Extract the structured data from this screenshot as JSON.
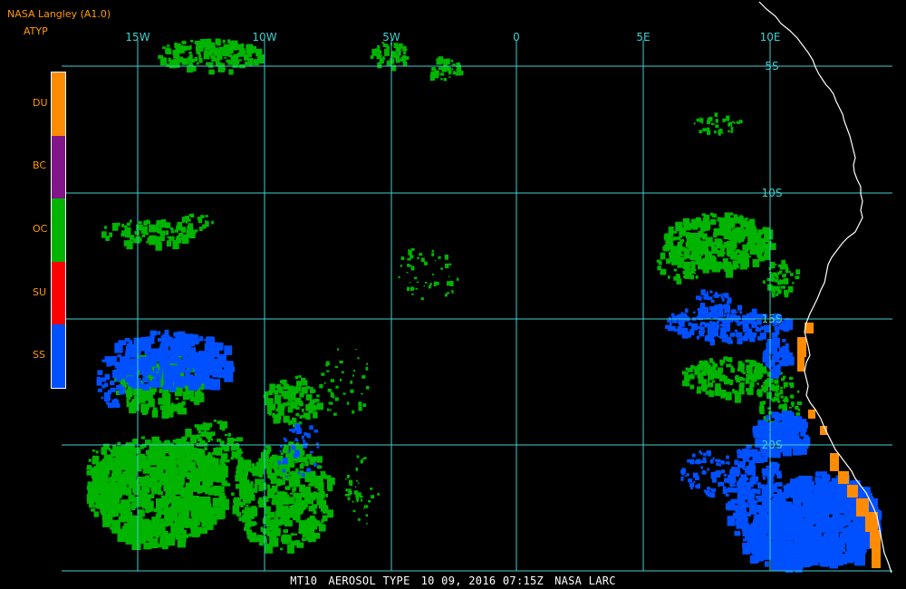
{
  "header": {
    "source": "NASA Langley (A1.0)",
    "product": "ATYP"
  },
  "legend": {
    "items": [
      {
        "code": "DU",
        "color": "#ff8c00"
      },
      {
        "code": "BC",
        "color": "#80168a"
      },
      {
        "code": "OC",
        "color": "#00b400"
      },
      {
        "code": "SU",
        "color": "#ff0000"
      },
      {
        "code": "SS",
        "color": "#0050ff"
      }
    ]
  },
  "longitudes": [
    "15W",
    "10W",
    "5W",
    "0",
    "5E",
    "10E"
  ],
  "latitudes": [
    "5S",
    "10S",
    "15S",
    "20S"
  ],
  "colors": {
    "grid": "#3fd0d0",
    "coast": "#ffffff",
    "label": "#ff9a00",
    "background": "#000000"
  },
  "footer": {
    "sensor": "MT10",
    "title": "AEROSOL TYPE",
    "datetime": "10 09, 2016 07:15Z",
    "credit": "NASA LARC"
  }
}
